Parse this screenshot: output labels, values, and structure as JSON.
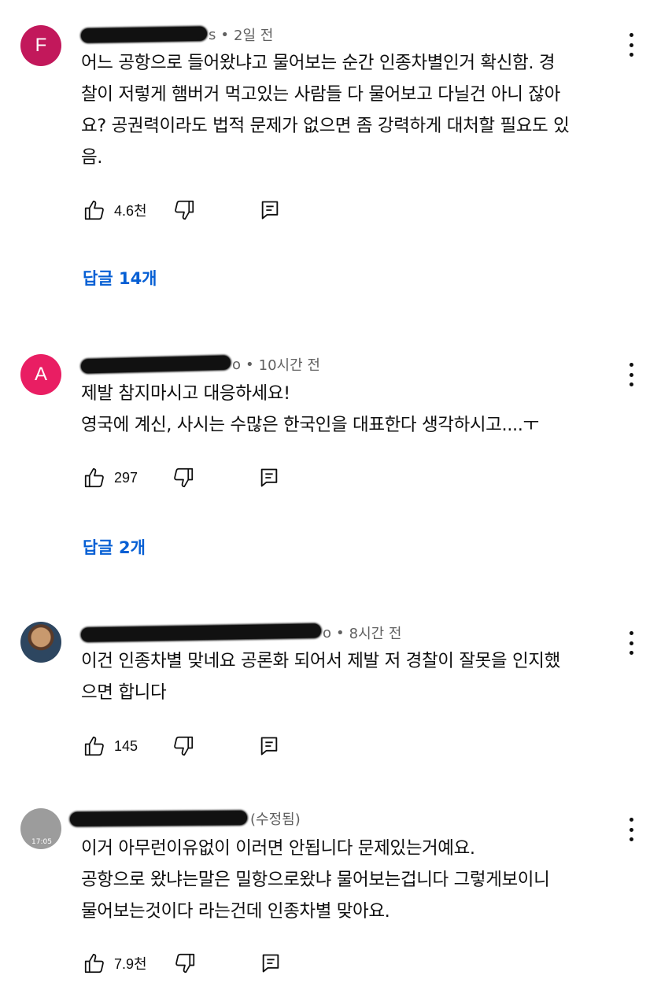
{
  "comments": [
    {
      "avatar_letter": "F",
      "avatar_color": "#c2185b",
      "handle_tail": "s",
      "time": "2일 전",
      "lines": [
        "어느 공항으로 들어왔냐고 물어보는 순간 인종차별인거 확신함. 경",
        "찰이 저렇게 햄버거 먹고있는 사람들 다 물어보고 다닐건 아니 잖아",
        "요? 공권력이라도 법적 문제가 없으면 좀 강력하게 대처할 필요도 있",
        "음."
      ],
      "likes": "4.6천",
      "replies": "답글 14개"
    },
    {
      "avatar_letter": "A",
      "avatar_color": "#e91e63",
      "handle_tail": "o",
      "time": "10시간 전",
      "lines": [
        "제발 참지마시고 대응하세요!",
        "영국에 계신, 사시는 수많은 한국인을 대표한다 생각하시고....ㅜ"
      ],
      "likes": "297",
      "replies": "답글 2개"
    },
    {
      "handle_tail": "o",
      "time": "8시간 전",
      "lines": [
        "이건 인종차별 맞네요 공론화 되어서 제발 저 경찰이 잘못을 인지했",
        "으면 합니다"
      ],
      "likes": "145"
    },
    {
      "avatar_caption": "17:05",
      "edited": "(수정됨)",
      "lines": [
        "이거 아무런이유없이 이러면 안됩니다 문제있는거예요.",
        "공항으로 왔냐는말은 밀항으로왔냐 물어보는겁니다 그렇게보이니",
        "물어보는것이다 라는건데 인종차별 맞아요."
      ],
      "likes": "7.9천"
    }
  ],
  "icons": {
    "like": "thumbs-up-icon",
    "dislike": "thumbs-down-icon",
    "reply": "reply-comment-icon",
    "more": "more-vert-icon"
  },
  "colors": {
    "link_blue": "#065fd4",
    "meta_grey": "#606060"
  }
}
